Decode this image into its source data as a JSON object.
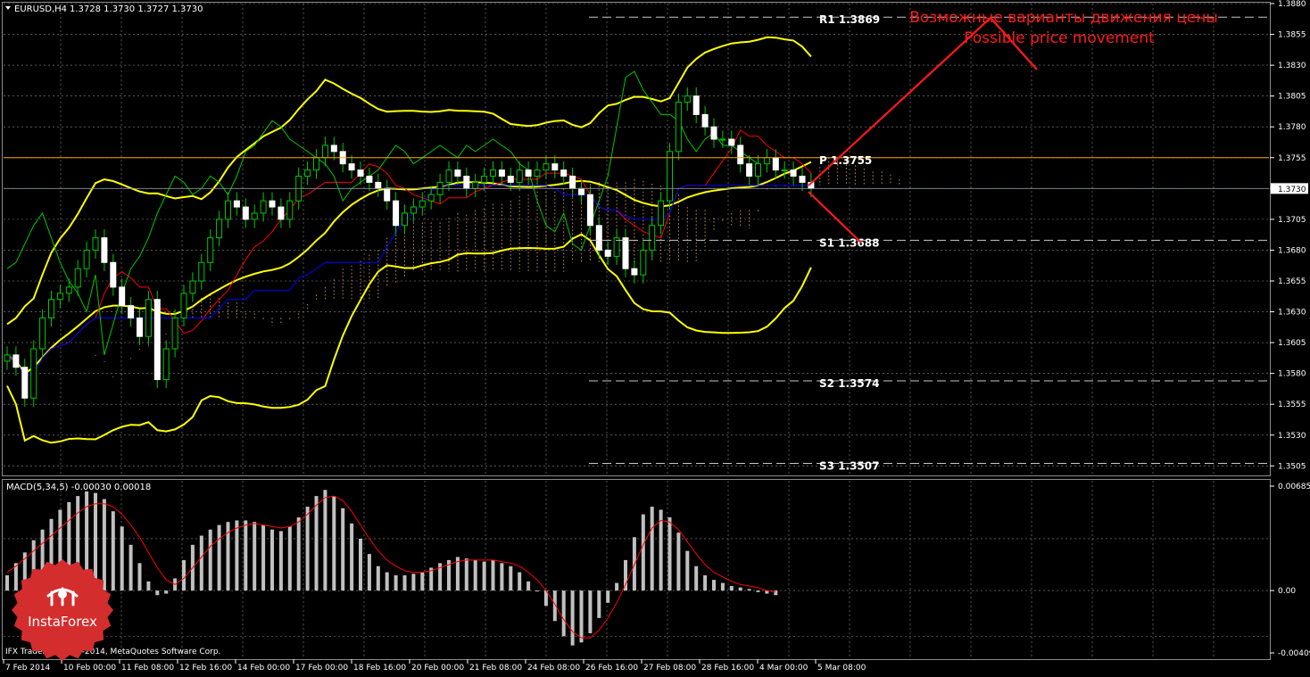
{
  "header": {
    "symbol": "EURUSD,H4",
    "ohlc": "1.3728 1.3730 1.3727 1.3730"
  },
  "annotation": {
    "ru": "Возможные варианты движения цены",
    "en": "Possible price movement"
  },
  "macd": {
    "label": "MACD(5,34,5) -0.00030 0.00018"
  },
  "footer": {
    "copyright": "IFX Trader, © 2001-2014, MetaQuotes Software Corp."
  },
  "logo": {
    "text": "InstaForex"
  },
  "colors": {
    "background": "#000000",
    "grid": "#8c8c8c",
    "bollinger": "#ffff00",
    "tenkan": "#ff0000",
    "kijun": "#0000ff",
    "chikou": "#00c800",
    "kumo": "#f4a460",
    "pivot": "#ffa500",
    "annotation": "#ff1a1a",
    "macd_hist": "#c0c0c0",
    "macd_signal": "#ff0000"
  },
  "chart_data": [
    {
      "type": "candlestick",
      "symbol": "EURUSD",
      "timeframe": "H4",
      "ylim": [
        1.3498,
        1.388
      ],
      "price_ticks": [
        "1.3880",
        "1.3855",
        "1.3830",
        "1.3805",
        "1.3780",
        "1.3755",
        "1.3730",
        "1.3705",
        "1.3680",
        "1.3655",
        "1.3630",
        "1.3605",
        "1.3580",
        "1.3555",
        "1.3530",
        "1.3505"
      ],
      "x_ticks": [
        "7 Feb 2014",
        "10 Feb 00:00",
        "11 Feb 08:00",
        "12 Feb 16:00",
        "14 Feb 00:00",
        "17 Feb 00:00",
        "18 Feb 16:00",
        "20 Feb 00:00",
        "21 Feb 08:00",
        "24 Feb 08:00",
        "26 Feb 16:00",
        "27 Feb 08:00",
        "28 Feb 16:00",
        "4 Mar 00:00",
        "5 Mar 08:00"
      ],
      "current_price": 1.373,
      "current_price_label": "1.3730",
      "levels": [
        {
          "name": "R1",
          "label": "R1  1.3869",
          "value": 1.3869
        },
        {
          "name": "P",
          "label": "P  1.3755",
          "value": 1.3755
        },
        {
          "name": "S1",
          "label": "S1  1.3688",
          "value": 1.3688
        },
        {
          "name": "S2",
          "label": "S2  1.3574",
          "value": 1.3574
        },
        {
          "name": "S3",
          "label": "S3  1.3507",
          "value": 1.3507
        }
      ],
      "close_path": [
        1.3595,
        1.3585,
        1.356,
        1.36,
        1.3625,
        1.364,
        1.3645,
        1.365,
        1.3665,
        1.368,
        1.369,
        1.367,
        1.365,
        1.3635,
        1.3625,
        1.361,
        1.364,
        1.3575,
        1.36,
        1.3625,
        1.3645,
        1.3655,
        1.367,
        1.369,
        1.3705,
        1.372,
        1.3715,
        1.3705,
        1.371,
        1.372,
        1.3715,
        1.3705,
        1.372,
        1.374,
        1.3745,
        1.3755,
        1.3765,
        1.376,
        1.375,
        1.3745,
        1.374,
        1.3735,
        1.373,
        1.372,
        1.37,
        1.371,
        1.3715,
        1.372,
        1.3725,
        1.3735,
        1.3745,
        1.374,
        1.373,
        1.3735,
        1.374,
        1.3745,
        1.374,
        1.3735,
        1.3745,
        1.374,
        1.3745,
        1.375,
        1.3745,
        1.374,
        1.373,
        1.3725,
        1.37,
        1.368,
        1.3675,
        1.369,
        1.3665,
        1.366,
        1.368,
        1.37,
        1.372,
        1.376,
        1.38,
        1.3805,
        1.379,
        1.378,
        1.377,
        1.377,
        1.3765,
        1.375,
        1.374,
        1.375,
        1.3755,
        1.3745,
        1.3745,
        1.374,
        1.3735,
        1.373
      ]
    },
    {
      "type": "bar",
      "name": "MACD(5,34,5)",
      "ylim": [
        -0.00409,
        0.00685
      ],
      "y_ticks": [
        "0.00685",
        "0.00",
        "-0.00409"
      ],
      "values": [
        0.001,
        0.0018,
        0.0025,
        0.0033,
        0.004,
        0.0047,
        0.0053,
        0.0058,
        0.0062,
        0.0065,
        0.0064,
        0.006,
        0.0052,
        0.0042,
        0.003,
        0.0018,
        0.0006,
        -0.0003,
        -0.0002,
        0.0008,
        0.002,
        0.003,
        0.0036,
        0.004,
        0.0043,
        0.0045,
        0.0046,
        0.0046,
        0.0045,
        0.0043,
        0.004,
        0.0039,
        0.0042,
        0.0048,
        0.0055,
        0.0062,
        0.0066,
        0.0062,
        0.0054,
        0.0044,
        0.0034,
        0.0024,
        0.0016,
        0.0012,
        0.001,
        0.001,
        0.0011,
        0.0012,
        0.0015,
        0.0018,
        0.002,
        0.0022,
        0.0021,
        0.002,
        0.0019,
        0.002,
        0.0018,
        0.0016,
        0.0012,
        0.0006,
        0.0,
        -0.001,
        -0.002,
        -0.003,
        -0.0036,
        -0.0034,
        -0.0028,
        -0.0018,
        -0.0008,
        0.0005,
        0.002,
        0.0035,
        0.005,
        0.0055,
        0.0053,
        0.0048,
        0.0038,
        0.0026,
        0.0016,
        0.001,
        0.0007,
        0.0005,
        0.0003,
        0.0002,
        0.0001,
        -0.0001,
        -0.0002,
        -0.0003
      ],
      "signal": [
        0.0012,
        0.0016,
        0.0021,
        0.0026,
        0.0031,
        0.0036,
        0.0041,
        0.0046,
        0.0051,
        0.0055,
        0.0057,
        0.0057,
        0.0055,
        0.005,
        0.0043,
        0.0035,
        0.0025,
        0.0015,
        0.0007,
        0.0004,
        0.0008,
        0.0015,
        0.0022,
        0.0029,
        0.0034,
        0.0038,
        0.0041,
        0.0043,
        0.0044,
        0.0043,
        0.0042,
        0.0041,
        0.0042,
        0.0045,
        0.005,
        0.0056,
        0.0061,
        0.0062,
        0.0059,
        0.0052,
        0.0043,
        0.0034,
        0.0026,
        0.002,
        0.0016,
        0.0013,
        0.0012,
        0.0012,
        0.0013,
        0.0015,
        0.0017,
        0.0019,
        0.002,
        0.002,
        0.002,
        0.002,
        0.0019,
        0.0018,
        0.0016,
        0.0012,
        0.0007,
        0.0,
        -0.0009,
        -0.0019,
        -0.0027,
        -0.0031,
        -0.0031,
        -0.0026,
        -0.0018,
        -0.0008,
        0.0004,
        0.0017,
        0.003,
        0.0041,
        0.0046,
        0.0045,
        0.004,
        0.0032,
        0.0024,
        0.0017,
        0.0012,
        0.0009,
        0.0006,
        0.0004,
        0.0003,
        0.0002,
        0.0,
        -0.0001
      ]
    }
  ]
}
